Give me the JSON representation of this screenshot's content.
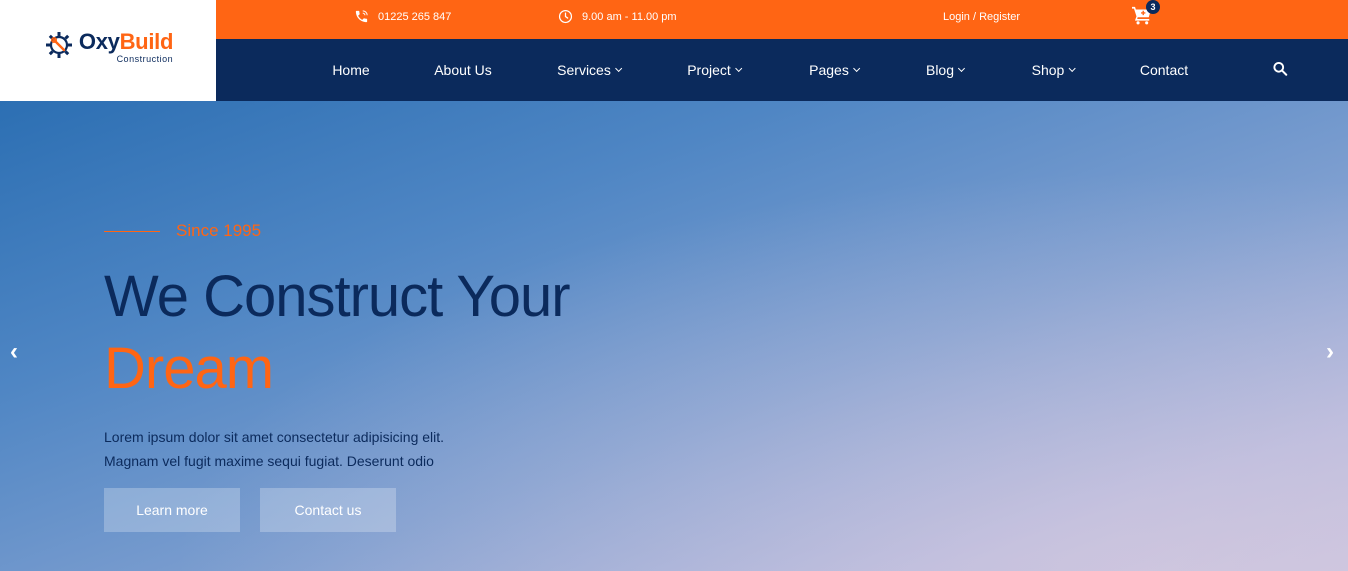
{
  "logo": {
    "name_part1": "Oxy",
    "name_part2": "Build",
    "subtitle": "Construction",
    "icon": "gear-wrench-icon"
  },
  "topbar": {
    "phone": "01225 265 847",
    "phone_icon": "phone-icon",
    "hours": "9.00 am - 11.00 pm",
    "hours_icon": "clock-icon",
    "login": "Login / Register",
    "cart_icon": "cart-icon",
    "cart_count": "3"
  },
  "nav": {
    "items": [
      {
        "label": "Home",
        "dropdown": false
      },
      {
        "label": "About Us",
        "dropdown": false
      },
      {
        "label": "Services",
        "dropdown": true
      },
      {
        "label": "Project",
        "dropdown": true
      },
      {
        "label": "Pages",
        "dropdown": true
      },
      {
        "label": "Blog",
        "dropdown": true
      },
      {
        "label": "Shop",
        "dropdown": true
      },
      {
        "label": "Contact",
        "dropdown": false
      }
    ],
    "search_icon": "search-icon"
  },
  "hero": {
    "since": "Since 1995",
    "headline_line1": "We Construct Your",
    "headline_line2": "Dream",
    "desc_line1": "Lorem ipsum dolor sit amet consectetur adipisicing elit.",
    "desc_line2": "Magnam vel fugit maxime sequi fugiat. Deserunt odio",
    "btn_learn": "Learn more",
    "btn_contact": "Contact us",
    "prev_arrow": "‹",
    "next_arrow": "›"
  },
  "colors": {
    "orange": "#ff6514",
    "navy": "#0b2a5c",
    "white": "#ffffff"
  }
}
